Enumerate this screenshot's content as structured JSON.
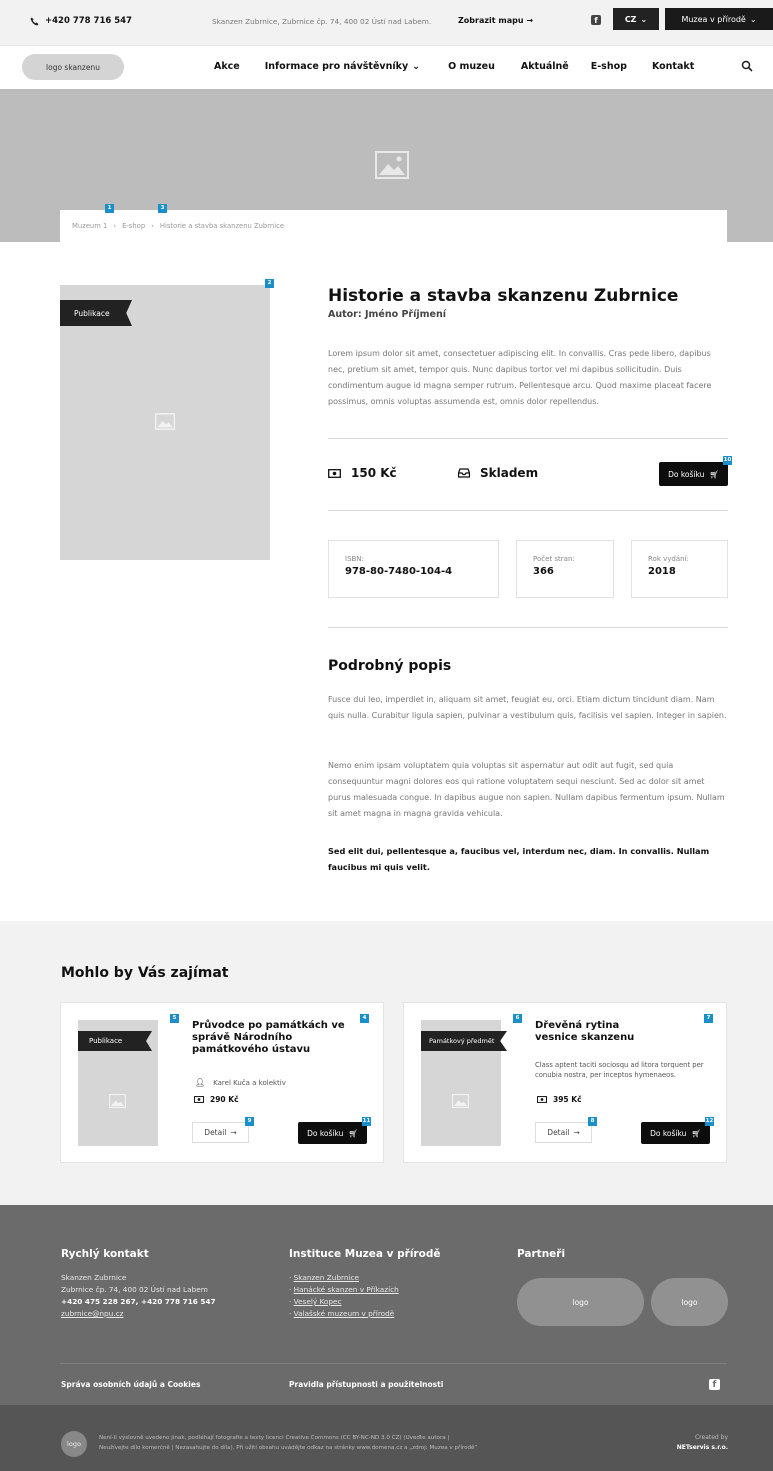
{
  "topbar": {
    "phone": "+420 778 716 547",
    "address": "Skanzen Zubrnice, Zubrnice čp. 74, 400 02 Ústí nad Labem.",
    "map_link": "Zobrazit mapu",
    "lang": "CZ",
    "museum_menu": "Muzea v přírodě"
  },
  "nav": {
    "logo": "logo skanzenu",
    "items": [
      "Akce",
      "Informace pro návštěvníky",
      "O muzeu",
      "Aktuálně",
      "E-shop",
      "Kontakt"
    ]
  },
  "breadcrumb": [
    "Muzeum 1",
    "E-shop",
    "Historie a stavba skanzenu Zubrnice"
  ],
  "badges": [
    "1",
    "2",
    "3",
    "4",
    "5",
    "6",
    "7",
    "8",
    "9",
    "10",
    "11",
    "12"
  ],
  "product": {
    "ribbon": "Publikace",
    "title": "Historie a stavba skanzenu Zubrnice",
    "author": "Autor: Jméno Příjmení",
    "intro": "Lorem ipsum dolor sit amet, consectetuer adipiscing elit. In convallis. Cras pede libero, dapibus nec, pretium sit amet, tempor quis. Nunc dapibus tortor vel mi dapibus sollicitudin. Duis condimentum augue id magna semper rutrum. Pellentesque arcu. Quod maxime placeat facere possimus, omnis voluptas assumenda est, omnis dolor repellendus.",
    "price": "150 Kč",
    "stock": "Skladem",
    "cart_button": "Do košíku",
    "isbn_label": "ISBN:",
    "isbn": "978-80-7480-104-4",
    "pages_label": "Počet stran:",
    "pages": "366",
    "year_label": "Rok vydání:",
    "year": "2018",
    "detail_heading": "Podrobný popis",
    "desc1": "Fusce dui leo, imperdiet in, aliquam sit amet, feugiat eu, orci. Etiam dictum tincidunt diam. Nam quis nulla. Curabitur ligula sapien, pulvinar a vestibulum quis, facilisis vel sapien. Integer in sapien.",
    "desc2": "Nemo enim ipsam voluptatem quia voluptas sit aspernatur aut odit aut fugit, sed quia consequuntur magni dolores eos qui ratione voluptatem sequi nesciunt. Sed ac dolor sit amet purus malesuada congue. In dapibus augue non sapien. Nullam dapibus fermentum ipsum. Nullam sit amet magna in magna gravida vehicula.",
    "desc_bold": "Sed elit dui, pellentesque a, faucibus vel, interdum nec, diam. In convallis. Nullam faucibus mi quis velit."
  },
  "related": {
    "title": "Mohlo by Vás zajímat",
    "cards": [
      {
        "ribbon": "Publikace",
        "title": "Průvodce po památkách ve správě Národního památkového ústavu",
        "author": "Karel Kuča a kolektiv",
        "price": "290 Kč",
        "detail": "Detail",
        "cart": "Do košíku"
      },
      {
        "ribbon": "Památkový předmět",
        "title": "Dřevěná rytina vesnice skanzenu",
        "desc": "Class aptent taciti sociosqu ad litora torquent per conubia nostra, per inceptos hymenaeos.",
        "price": "395 Kč",
        "detail": "Detail",
        "cart": "Do košíku"
      }
    ]
  },
  "footer": {
    "contact_heading": "Rychlý kontakt",
    "contact_name": "Skanzen Zubrnice",
    "contact_address": "Zubrnice čp. 74, 400 02 Ústí nad Labem",
    "contact_phones": "+420 475 228 267, +420 778 716 547",
    "contact_email": "zubrnice@npu.cz",
    "institutions_heading": "Instituce Muzea v přírodě",
    "institutions": [
      "Skanzen Zubrnice",
      "Hanácké skanzen v Příkazích",
      "Veselý Kopec",
      "Valašské muzeum v přírodě"
    ],
    "partners_heading": "Partneři",
    "partner_logo": "logo",
    "privacy_link": "Správa osobních údajů a Cookies",
    "accessibility_link": "Pravidla přístupnosti a použitelnosti",
    "bottom_logo": "logo",
    "license_line1": "Není-li výslovně uvedeno jinak, podléhají fotografie a texty licenci Creative Commons (CC BY-NC-ND 3.0 CZ) (Uveďte autora |",
    "license_line2": "Neužívejte dílo komerčně | Nezasahujte do díla). Při užití obsahu uvádějte odkaz na stránky www.domena.cz a „zdroj: Muzea v přírodě“",
    "created_by": "Created by",
    "created_company": "NETservis s.r.o."
  }
}
